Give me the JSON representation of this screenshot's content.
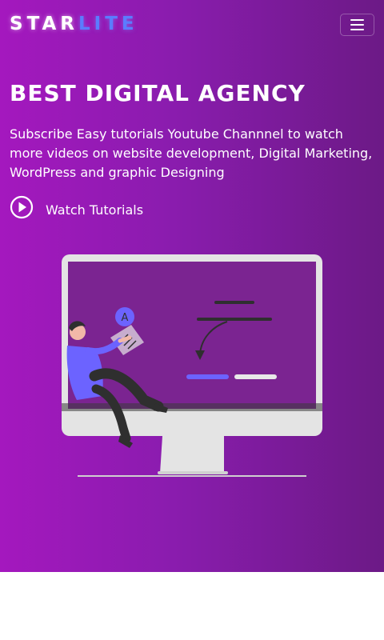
{
  "navbar": {
    "brand_part1": "STAR",
    "brand_part2": "LITE",
    "menu_icon": "hamburger-menu-icon"
  },
  "hero": {
    "title": "BEST DIGITAL AGENCY",
    "description": "Subscribe Easy tutorials Youtube Channnel to watch more videos on website development, Digital Marketing, WordPress and graphic Designing",
    "watch_label": "Watch Tutorials",
    "watch_icon": "play-circle-icon",
    "illustration": "person-at-monitor-illustration"
  },
  "colors": {
    "gradient_start": "#a418be",
    "gradient_end": "#6c1a86",
    "brand_accent": "#5b7cff",
    "page_background": "#ffffff"
  }
}
